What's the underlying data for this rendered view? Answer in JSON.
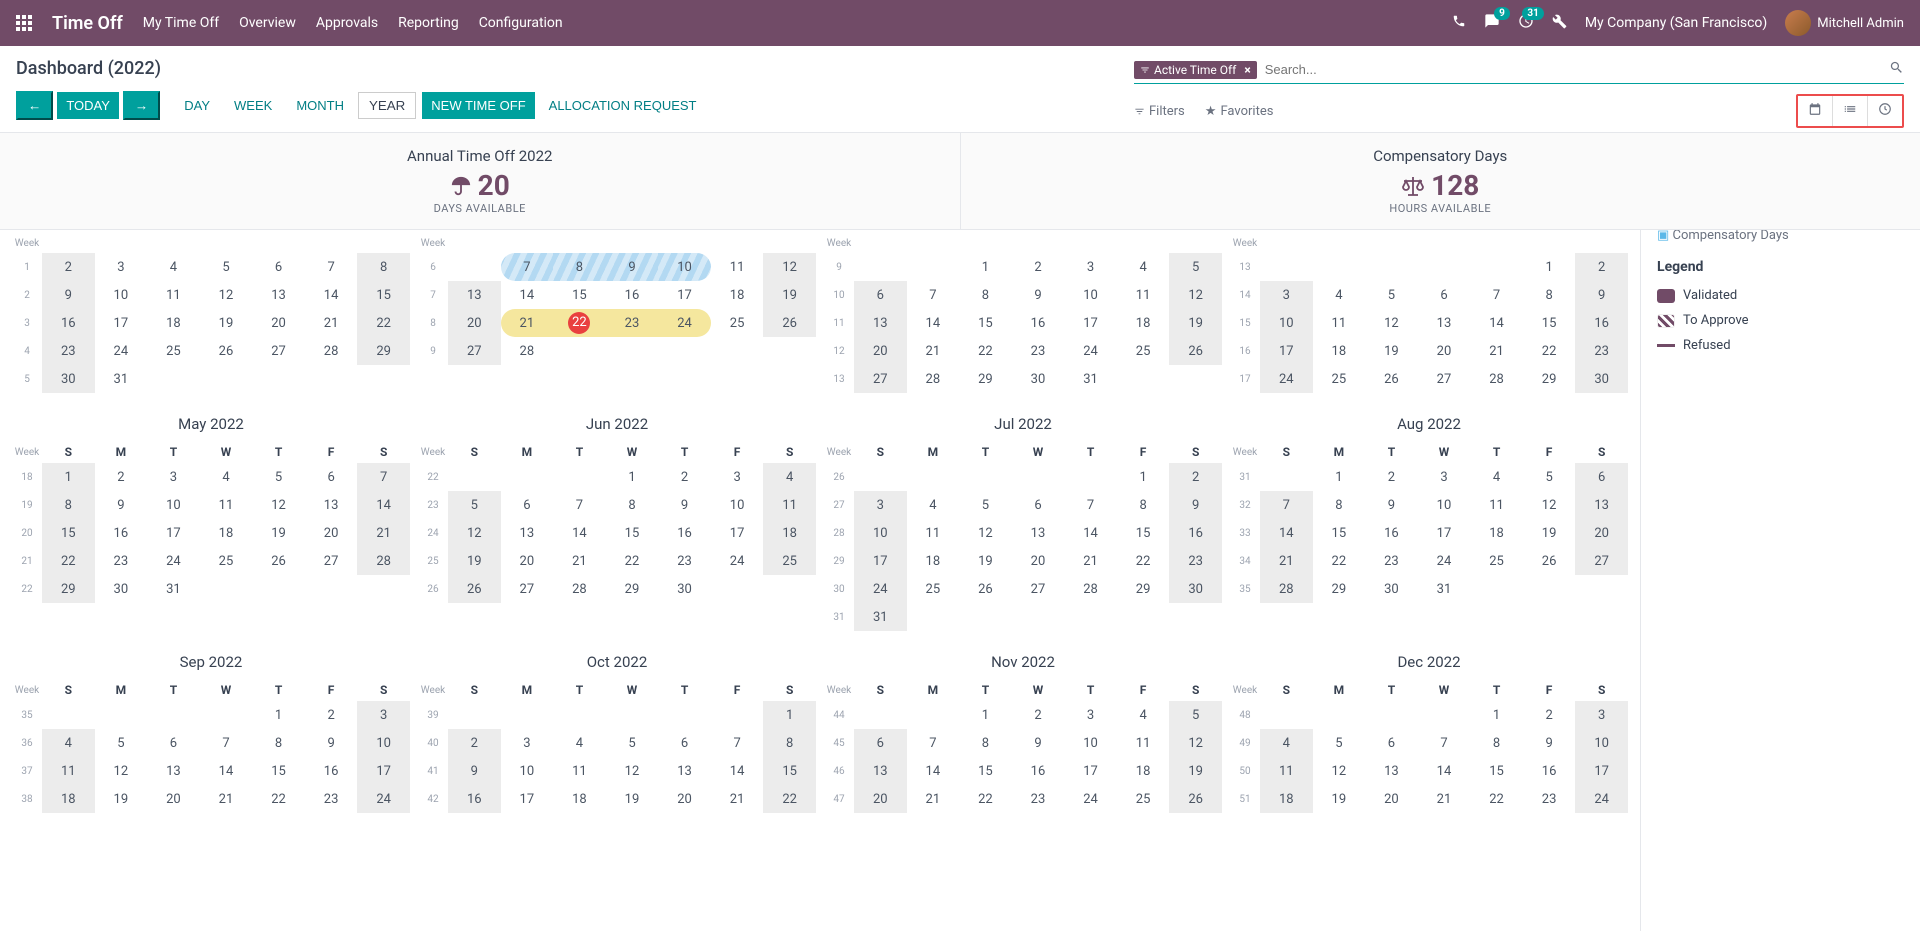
{
  "nav": {
    "app_title": "Time Off",
    "links": [
      "My Time Off",
      "Overview",
      "Approvals",
      "Reporting",
      "Configuration"
    ],
    "msg_count": "9",
    "activity_count": "31",
    "company": "My Company (San Francisco)",
    "user": "Mitchell Admin"
  },
  "page": {
    "title": "Dashboard (2022)",
    "today": "TODAY",
    "day": "DAY",
    "week": "WEEK",
    "month": "MONTH",
    "year": "YEAR",
    "new_time_off": "NEW TIME OFF",
    "alloc_request": "ALLOCATION REQUEST"
  },
  "search": {
    "tag_label": "Active Time Off",
    "placeholder": "Search...",
    "filters": "Filters",
    "favorites": "Favorites"
  },
  "summary": {
    "annual": {
      "title": "Annual Time Off 2022",
      "value": "20",
      "sub": "DAYS AVAILABLE"
    },
    "comp": {
      "title": "Compensatory Days",
      "value": "128",
      "sub": "HOURS AVAILABLE"
    }
  },
  "sidebar": {
    "cut_item": "Compensatory Days",
    "legend_title": "Legend",
    "validated": "Validated",
    "to_approve": "To Approve",
    "refused": "Refused"
  },
  "cal": {
    "week_label": "Week",
    "days": [
      "S",
      "M",
      "T",
      "W",
      "T",
      "F",
      "S"
    ],
    "months_top": [
      {
        "weeks": [
          [
            1,
            "2",
            "3",
            "4",
            "5",
            "6",
            "7",
            "8"
          ],
          [
            2,
            "9",
            "10",
            "11",
            "12",
            "13",
            "14",
            "15"
          ],
          [
            3,
            "16",
            "17",
            "18",
            "19",
            "20",
            "21",
            "22"
          ],
          [
            4,
            "23",
            "24",
            "25",
            "26",
            "27",
            "28",
            "29"
          ],
          [
            5,
            "30",
            "31",
            "",
            "",
            "",
            "",
            ""
          ]
        ]
      },
      {
        "special": "feb",
        "weeks": [
          [
            6,
            "",
            "7",
            "8",
            "9",
            "10",
            "11",
            "12"
          ],
          [
            7,
            "13",
            "14",
            "15",
            "16",
            "17",
            "18",
            "19"
          ],
          [
            8,
            "20",
            "21",
            "22",
            "23",
            "24",
            "25",
            "26"
          ],
          [
            9,
            "27",
            "28",
            "",
            "",
            "",
            "",
            ""
          ]
        ]
      },
      {
        "weeks": [
          [
            9,
            "",
            "",
            "1",
            "2",
            "3",
            "4",
            "5"
          ],
          [
            10,
            "6",
            "7",
            "8",
            "9",
            "10",
            "11",
            "12"
          ],
          [
            11,
            "13",
            "14",
            "15",
            "16",
            "17",
            "18",
            "19"
          ],
          [
            12,
            "20",
            "21",
            "22",
            "23",
            "24",
            "25",
            "26"
          ],
          [
            13,
            "27",
            "28",
            "29",
            "30",
            "31",
            "",
            ""
          ]
        ]
      },
      {
        "weeks": [
          [
            13,
            "",
            "",
            "",
            "",
            "",
            "1",
            "2"
          ],
          [
            14,
            "3",
            "4",
            "5",
            "6",
            "7",
            "8",
            "9"
          ],
          [
            15,
            "10",
            "11",
            "12",
            "13",
            "14",
            "15",
            "16"
          ],
          [
            16,
            "17",
            "18",
            "19",
            "20",
            "21",
            "22",
            "23"
          ],
          [
            17,
            "24",
            "25",
            "26",
            "27",
            "28",
            "29",
            "30"
          ]
        ]
      }
    ],
    "months_main": [
      {
        "title": "May 2022",
        "weeks": [
          [
            18,
            "1",
            "2",
            "3",
            "4",
            "5",
            "6",
            "7"
          ],
          [
            19,
            "8",
            "9",
            "10",
            "11",
            "12",
            "13",
            "14"
          ],
          [
            20,
            "15",
            "16",
            "17",
            "18",
            "19",
            "20",
            "21"
          ],
          [
            21,
            "22",
            "23",
            "24",
            "25",
            "26",
            "27",
            "28"
          ],
          [
            22,
            "29",
            "30",
            "31",
            "",
            "",
            "",
            ""
          ]
        ]
      },
      {
        "title": "Jun 2022",
        "weeks": [
          [
            22,
            "",
            "",
            "",
            "1",
            "2",
            "3",
            "4"
          ],
          [
            23,
            "5",
            "6",
            "7",
            "8",
            "9",
            "10",
            "11"
          ],
          [
            24,
            "12",
            "13",
            "14",
            "15",
            "16",
            "17",
            "18"
          ],
          [
            25,
            "19",
            "20",
            "21",
            "22",
            "23",
            "24",
            "25"
          ],
          [
            26,
            "26",
            "27",
            "28",
            "29",
            "30",
            "",
            ""
          ]
        ]
      },
      {
        "title": "Jul 2022",
        "weeks": [
          [
            26,
            "",
            "",
            "",
            "",
            "",
            "1",
            "2"
          ],
          [
            27,
            "3",
            "4",
            "5",
            "6",
            "7",
            "8",
            "9"
          ],
          [
            28,
            "10",
            "11",
            "12",
            "13",
            "14",
            "15",
            "16"
          ],
          [
            29,
            "17",
            "18",
            "19",
            "20",
            "21",
            "22",
            "23"
          ],
          [
            30,
            "24",
            "25",
            "26",
            "27",
            "28",
            "29",
            "30"
          ],
          [
            31,
            "31",
            "",
            "",
            "",
            "",
            "",
            ""
          ]
        ]
      },
      {
        "title": "Aug 2022",
        "weeks": [
          [
            31,
            "",
            "1",
            "2",
            "3",
            "4",
            "5",
            "6"
          ],
          [
            32,
            "7",
            "8",
            "9",
            "10",
            "11",
            "12",
            "13"
          ],
          [
            33,
            "14",
            "15",
            "16",
            "17",
            "18",
            "19",
            "20"
          ],
          [
            34,
            "21",
            "22",
            "23",
            "24",
            "25",
            "26",
            "27"
          ],
          [
            35,
            "28",
            "29",
            "30",
            "31",
            "",
            "",
            ""
          ]
        ]
      },
      {
        "title": "Sep 2022",
        "weeks": [
          [
            35,
            "",
            "",
            "",
            "",
            "1",
            "2",
            "3"
          ],
          [
            36,
            "4",
            "5",
            "6",
            "7",
            "8",
            "9",
            "10"
          ],
          [
            37,
            "11",
            "12",
            "13",
            "14",
            "15",
            "16",
            "17"
          ],
          [
            38,
            "18",
            "19",
            "20",
            "21",
            "22",
            "23",
            "24"
          ]
        ]
      },
      {
        "title": "Oct 2022",
        "weeks": [
          [
            39,
            "",
            "",
            "",
            "",
            "",
            "",
            "1"
          ],
          [
            40,
            "2",
            "3",
            "4",
            "5",
            "6",
            "7",
            "8"
          ],
          [
            41,
            "9",
            "10",
            "11",
            "12",
            "13",
            "14",
            "15"
          ],
          [
            42,
            "16",
            "17",
            "18",
            "19",
            "20",
            "21",
            "22"
          ]
        ]
      },
      {
        "title": "Nov 2022",
        "weeks": [
          [
            44,
            "",
            "",
            "1",
            "2",
            "3",
            "4",
            "5"
          ],
          [
            45,
            "6",
            "7",
            "8",
            "9",
            "10",
            "11",
            "12"
          ],
          [
            46,
            "13",
            "14",
            "15",
            "16",
            "17",
            "18",
            "19"
          ],
          [
            47,
            "20",
            "21",
            "22",
            "23",
            "24",
            "25",
            "26"
          ]
        ]
      },
      {
        "title": "Dec 2022",
        "weeks": [
          [
            48,
            "",
            "",
            "",
            "",
            "1",
            "2",
            "3"
          ],
          [
            49,
            "4",
            "5",
            "6",
            "7",
            "8",
            "9",
            "10"
          ],
          [
            50,
            "11",
            "12",
            "13",
            "14",
            "15",
            "16",
            "17"
          ],
          [
            51,
            "18",
            "19",
            "20",
            "21",
            "22",
            "23",
            "24"
          ]
        ]
      }
    ]
  }
}
